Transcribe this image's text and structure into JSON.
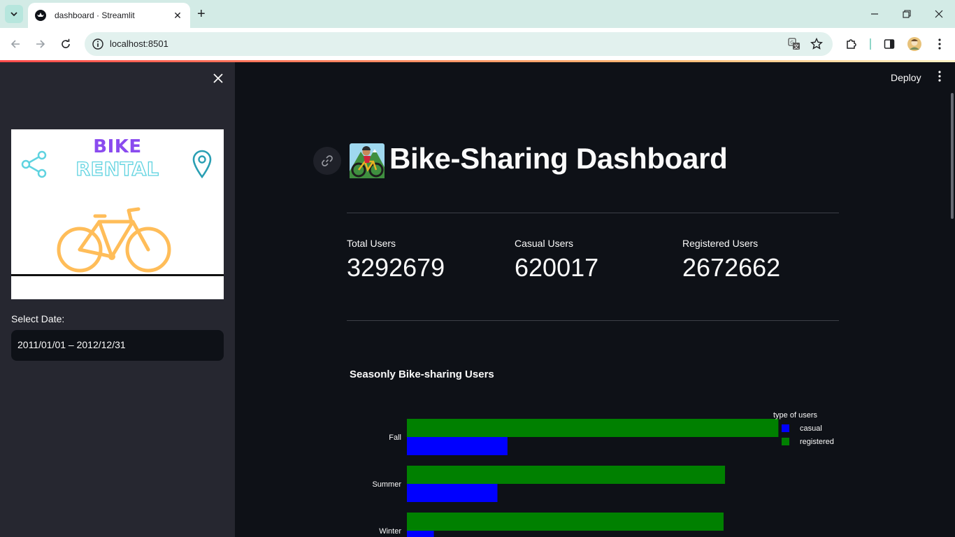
{
  "browser": {
    "tab_title": "dashboard · Streamlit",
    "url": "localhost:8501"
  },
  "sidebar": {
    "logo": {
      "line1": "BIKE",
      "line2": "RENTAL"
    },
    "select_date_label": "Select Date:",
    "date_range_value": "2011/01/01 – 2012/12/31"
  },
  "header": {
    "deploy_label": "Deploy"
  },
  "main": {
    "title": "Bike-Sharing Dashboard",
    "metrics": [
      {
        "label": "Total Users",
        "value": "3292679"
      },
      {
        "label": "Casual Users",
        "value": "620017"
      },
      {
        "label": "Registered Users",
        "value": "2672662"
      }
    ]
  },
  "chart_data": {
    "type": "bar",
    "orientation": "horizontal",
    "title": "Seasonly Bike-sharing Users",
    "categories": [
      "Fall",
      "Summer",
      "Winter"
    ],
    "series": [
      {
        "name": "casual",
        "color": "#0000ff",
        "values": [
          226091,
          203522,
          60622
        ]
      },
      {
        "name": "registered",
        "color": "#008000",
        "values": [
          835038,
          715067,
          711831
        ]
      }
    ],
    "legend_title": "type of users",
    "legend_position": "top-right",
    "xlim": [
      0,
      880000
    ],
    "grid": false
  },
  "colors": {
    "app_bg": "#0e1117",
    "sidebar_bg": "#262730",
    "text": "#fafafa",
    "accent_line": "#ff4b4b"
  }
}
